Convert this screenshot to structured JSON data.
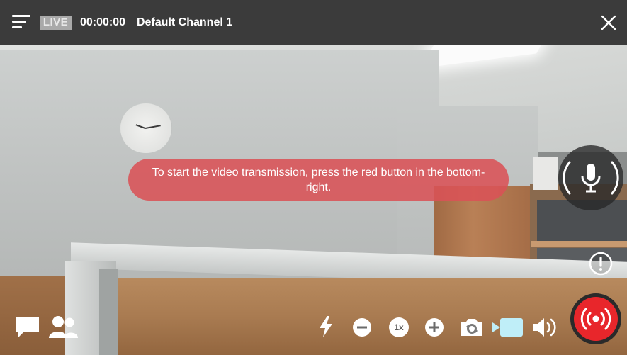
{
  "header": {
    "live_label": "LIVE",
    "timer": "00:00:00",
    "channel_name": "Default Channel 1"
  },
  "notice": {
    "message": "To start the video transmission, press the red button in the bottom-right."
  },
  "bottom_bar": {
    "zoom_level": "1x"
  },
  "icons": {
    "menu": "menu-icon",
    "close": "close-icon",
    "microphone": "microphone-icon",
    "alert": "alert-icon",
    "record": "broadcast-icon",
    "chat": "chat-icon",
    "participants": "participants-icon",
    "flash": "flash-icon",
    "zoom_out": "zoom-out-icon",
    "zoom_in": "zoom-in-icon",
    "camera_switch": "camera-switch-icon",
    "video": "video-camera-icon",
    "volume": "volume-icon"
  },
  "colors": {
    "topbar": "#3b3b3b",
    "live_badge": "#a9a9a9",
    "notice_bg": "#da5256",
    "record_red": "#e8262b",
    "video_active": "#bfeef8"
  }
}
